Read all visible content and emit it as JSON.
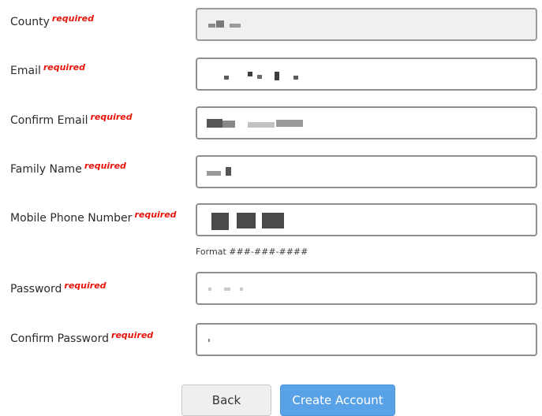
{
  "required_marker": "required",
  "fields": {
    "county": {
      "label": "County",
      "value": ""
    },
    "email": {
      "label": "Email",
      "value": ""
    },
    "confirm_email": {
      "label": "Confirm Email",
      "value": ""
    },
    "family_name": {
      "label": "Family Name",
      "value": ""
    },
    "mobile_phone": {
      "label": "Mobile Phone Number",
      "value": "",
      "hint": "Format ###-###-####"
    },
    "password": {
      "label": "Password",
      "value": ""
    },
    "confirm_password": {
      "label": "Confirm Password",
      "value": ""
    }
  },
  "buttons": {
    "back": "Back",
    "create_account": "Create Account"
  },
  "colors": {
    "required": "#e8140c",
    "primary_button": "#59a2e8",
    "field_border": "#8f8f8f",
    "disabled_field_bg": "#f0f0f0"
  }
}
